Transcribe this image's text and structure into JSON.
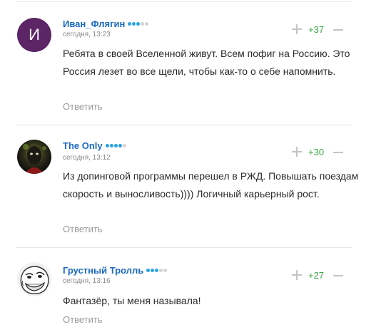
{
  "comments": [
    {
      "avatar": "И",
      "author": "Иван_Флягин",
      "level": 3,
      "date": "сегодня, 13:23",
      "text": "Ребята в своей Вселенной живут. Всем пофиг на Россию. Это Россия лезет во все щели, чтобы как-то о себе напомнить.",
      "score": "+37",
      "reply_label": "Ответить"
    },
    {
      "avatar": "dark-portrait",
      "author": "The Only",
      "level": 4,
      "date": "сегодня, 13:12",
      "text": "Из допинговой программы перешел в РЖД. Повышать поездам скорость и выносливость)))) Логичный карьерный рост.",
      "score": "+30",
      "reply_label": "Ответить"
    },
    {
      "avatar": "troll-face",
      "author": "Грустный Тролль",
      "level": 3,
      "date": "сегодня, 13:16",
      "text": "Фантазёр, ты меня называла!",
      "score": "+27",
      "reply_label": "Ответить"
    }
  ],
  "colors": {
    "author": "#1c6abf",
    "score": "#3aa843",
    "dot_on": "#2aa3e3",
    "dot_off": "#d4d4d4"
  }
}
